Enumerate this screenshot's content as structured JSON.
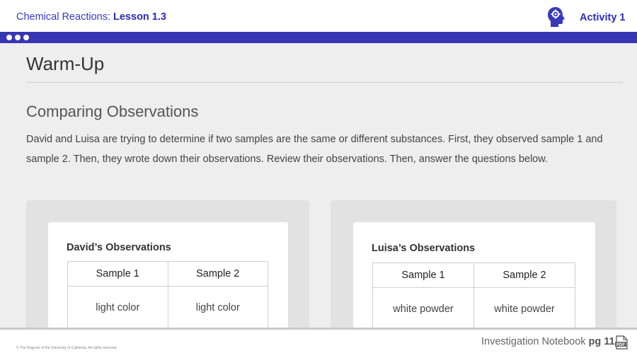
{
  "header": {
    "course": "Chemical Reactions:",
    "lesson": "Lesson 1.3",
    "icon": "head-gear-icon",
    "activity": "Activity 1"
  },
  "colors": {
    "brand_blue": "#3636b4",
    "panel_gray": "#e2e2e2"
  },
  "main": {
    "section_title": "Warm-Up",
    "subtitle": "Comparing Observations",
    "intro": "David and Luisa are trying to determine if two samples are the same or different substances. First, they observed sample 1 and sample 2. Then, they wrote down their observations. Review their observations. Then, answer the questions below."
  },
  "observations": [
    {
      "title": "David’s Observations",
      "columns": [
        "Sample 1",
        "Sample 2"
      ],
      "rows": [
        [
          "light color",
          "light color"
        ]
      ]
    },
    {
      "title": "Luisa’s Observations",
      "columns": [
        "Sample 1",
        "Sample 2"
      ],
      "rows": [
        [
          "white powder",
          "white powder"
        ]
      ]
    }
  ],
  "footer": {
    "copyright": "© The Regents of the University of California. All rights reserved.",
    "notebook": "Investigation Notebook",
    "page": "pg 11",
    "pdf_icon": "pdf-icon"
  }
}
